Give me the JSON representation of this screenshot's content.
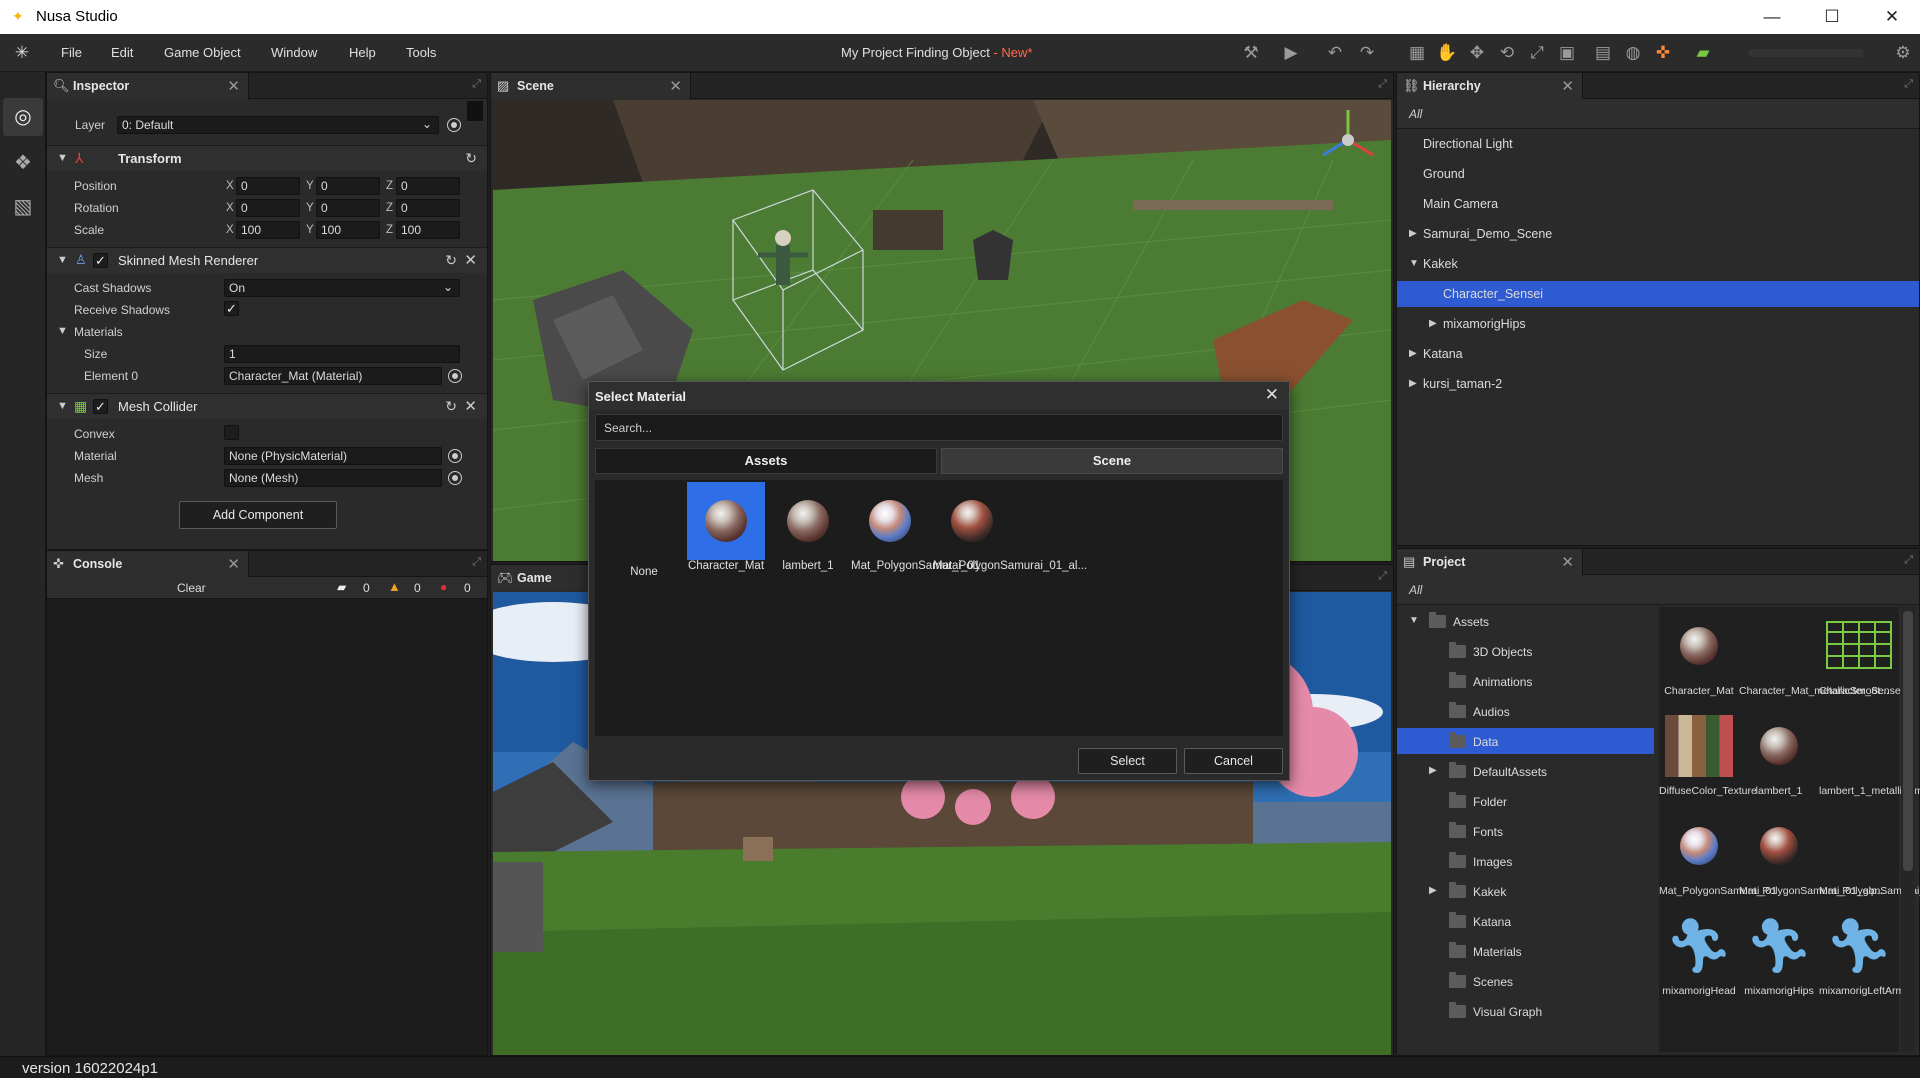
{
  "app": {
    "title": "Nusa Studio",
    "project_title": "My Project Finding Object",
    "project_status": "- New*",
    "version": "version 16022024p1"
  },
  "colors": {
    "accent": "#2e5bd1",
    "selected_material": "#2e6ee6",
    "new_badge": "#ff6b4a"
  },
  "menu": [
    "File",
    "Edit",
    "Game Object",
    "Window",
    "Help",
    "Tools"
  ],
  "toolbar_icons": [
    "hammer-icon",
    "play-icon",
    "undo-icon",
    "redo-icon",
    "grid-icon",
    "hand-icon",
    "move-icon",
    "rotate-icon",
    "scale-icon",
    "rect-icon",
    "build-icon",
    "globe-icon",
    "transform-icon",
    "android-icon",
    "settings-icon"
  ],
  "inspector": {
    "tab": "Inspector",
    "layer_label": "Layer",
    "layer_value": "0: Default",
    "transform": {
      "title": "Transform",
      "position": {
        "label": "Position",
        "x": "0",
        "y": "0",
        "z": "0"
      },
      "rotation": {
        "label": "Rotation",
        "x": "0",
        "y": "0",
        "z": "0"
      },
      "scale": {
        "label": "Scale",
        "x": "100",
        "y": "100",
        "z": "100"
      }
    },
    "axes": {
      "x": "X",
      "y": "Y",
      "z": "Z"
    },
    "skinned": {
      "title": "Skinned Mesh Renderer",
      "cast_label": "Cast Shadows",
      "cast_value": "On",
      "receive_label": "Receive Shadows",
      "materials_label": "Materials",
      "size_label": "Size",
      "size_value": "1",
      "element_label": "Element 0",
      "element_value": "Character_Mat (Material)"
    },
    "collider": {
      "title": "Mesh Collider",
      "convex_label": "Convex",
      "material_label": "Material",
      "material_value": "None (PhysicMaterial)",
      "mesh_label": "Mesh",
      "mesh_value": "None (Mesh)"
    },
    "add_component": "Add Component"
  },
  "console": {
    "tab": "Console",
    "clear": "Clear",
    "messages": "0",
    "warnings": "0",
    "errors": "0"
  },
  "scene": {
    "tab": "Scene"
  },
  "game": {
    "tab": "Game"
  },
  "hierarchy": {
    "tab": "Hierarchy",
    "filter": "All",
    "items": [
      {
        "label": "Directional Light",
        "arrow": "",
        "indent": 0
      },
      {
        "label": "Ground",
        "arrow": "",
        "indent": 0
      },
      {
        "label": "Main Camera",
        "arrow": "",
        "indent": 0
      },
      {
        "label": "Samurai_Demo_Scene",
        "arrow": "▶",
        "indent": 0
      },
      {
        "label": "Kakek",
        "arrow": "▼",
        "indent": 0
      },
      {
        "label": "Character_Sensei",
        "arrow": "",
        "indent": 1,
        "selected": true
      },
      {
        "label": "mixamorigHips",
        "arrow": "▶",
        "indent": 1
      },
      {
        "label": "Katana",
        "arrow": "▶",
        "indent": 0
      },
      {
        "label": "kursi_taman-2",
        "arrow": "▶",
        "indent": 0
      }
    ]
  },
  "project": {
    "tab": "Project",
    "filter": "All",
    "tree": [
      {
        "label": "Assets",
        "arrow": "▼",
        "indent": 0
      },
      {
        "label": "3D Objects",
        "arrow": "",
        "indent": 1
      },
      {
        "label": "Animations",
        "arrow": "",
        "indent": 1
      },
      {
        "label": "Audios",
        "arrow": "",
        "indent": 1
      },
      {
        "label": "Data",
        "arrow": "",
        "indent": 1,
        "selected": true
      },
      {
        "label": "DefaultAssets",
        "arrow": "▶",
        "indent": 1
      },
      {
        "label": "Folder",
        "arrow": "",
        "indent": 1
      },
      {
        "label": "Fonts",
        "arrow": "",
        "indent": 1
      },
      {
        "label": "Images",
        "arrow": "",
        "indent": 1
      },
      {
        "label": "Kakek",
        "arrow": "▶",
        "indent": 1
      },
      {
        "label": "Katana",
        "arrow": "",
        "indent": 1
      },
      {
        "label": "Materials",
        "arrow": "",
        "indent": 1
      },
      {
        "label": "Scenes",
        "arrow": "",
        "indent": 1
      },
      {
        "label": "Visual Graph",
        "arrow": "",
        "indent": 1
      }
    ],
    "assets": [
      {
        "label": "Character_Mat",
        "kind": "sphere"
      },
      {
        "label": "Character_Mat_metallicSmoot...",
        "kind": "blank"
      },
      {
        "label": "Character_Sensei",
        "kind": "mesh"
      },
      {
        "label": "DiffuseColor_Texture",
        "kind": "texture"
      },
      {
        "label": "lambert_1",
        "kind": "sphere"
      },
      {
        "label": "lambert_1_metallicSmoothne...",
        "kind": "blank"
      },
      {
        "label": "Mat_PolygonSamurai_01",
        "kind": "sphere2"
      },
      {
        "label": "Mat_PolygonSamurai_01_alp...",
        "kind": "sphere3"
      },
      {
        "label": "Mat_PolygonSamurai_01_me...",
        "kind": "blank"
      },
      {
        "label": "mixamorigHead",
        "kind": "figure"
      },
      {
        "label": "mixamorigHips",
        "kind": "figure"
      },
      {
        "label": "mixamorigLeftArm",
        "kind": "figure"
      }
    ]
  },
  "dialog": {
    "title": "Select Material",
    "search_placeholder": "Search...",
    "tabs": [
      "Assets",
      "Scene"
    ],
    "items": [
      {
        "label": "None",
        "kind": "none"
      },
      {
        "label": "Character_Mat",
        "kind": "sphere",
        "selected": true
      },
      {
        "label": "lambert_1",
        "kind": "sphere"
      },
      {
        "label": "Mat_PolygonSamurai_01",
        "kind": "sphere2"
      },
      {
        "label": "Mat_PolygonSamurai_01_al...",
        "kind": "sphere3"
      }
    ],
    "select": "Select",
    "cancel": "Cancel"
  }
}
